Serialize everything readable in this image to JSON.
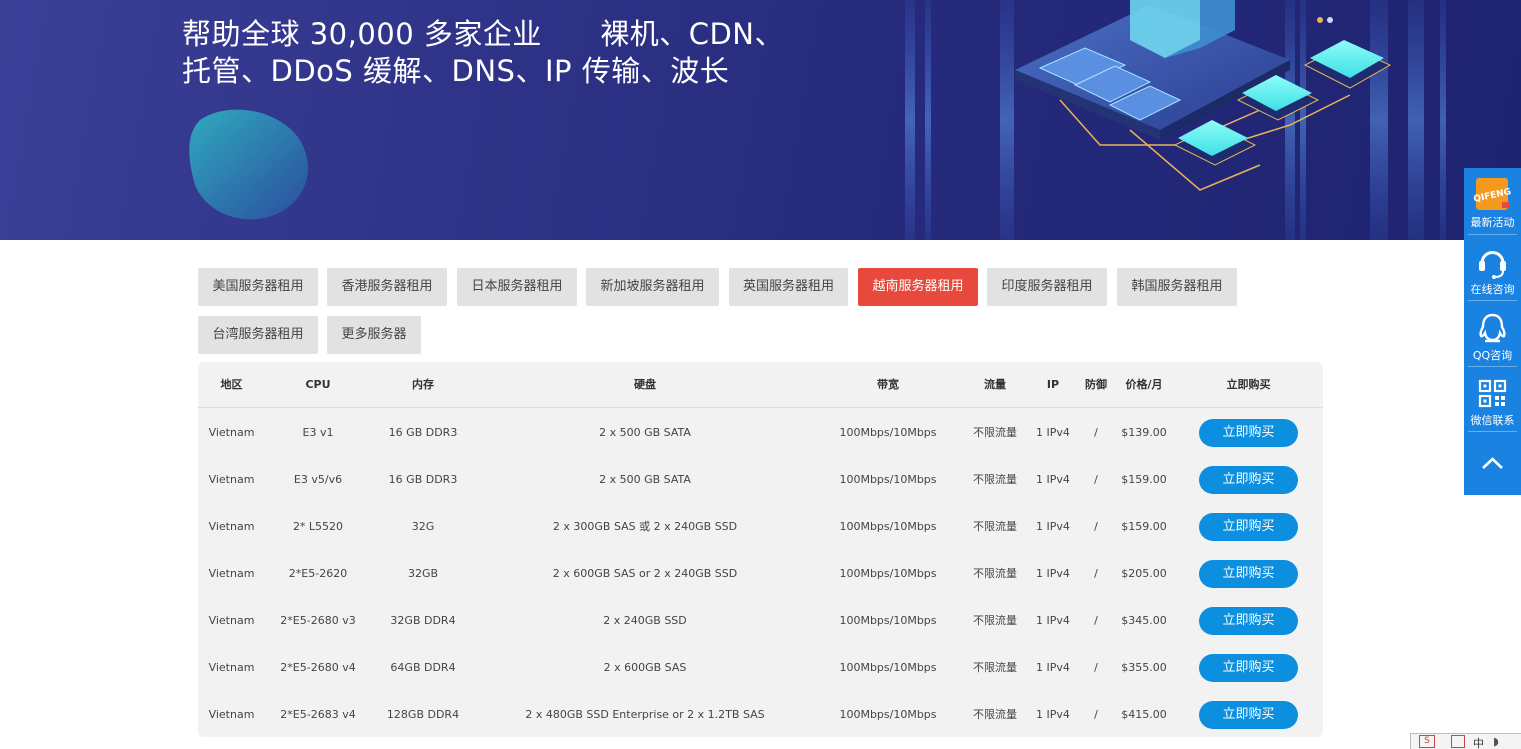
{
  "banner": {
    "line1": "帮助全球 30,000 多家企业      裸机、CDN、",
    "line2": "托管、DDoS 缓解、DNS、IP 传输、波长"
  },
  "tabs": [
    {
      "label": "美国服务器租用",
      "active": false
    },
    {
      "label": "香港服务器租用",
      "active": false
    },
    {
      "label": "日本服务器租用",
      "active": false
    },
    {
      "label": "新加坡服务器租用",
      "active": false
    },
    {
      "label": "英国服务器租用",
      "active": false
    },
    {
      "label": "越南服务器租用",
      "active": true
    },
    {
      "label": "印度服务器租用",
      "active": false
    },
    {
      "label": "韩国服务器租用",
      "active": false
    },
    {
      "label": "台湾服务器租用",
      "active": false
    },
    {
      "label": "更多服务器",
      "active": false
    }
  ],
  "table": {
    "headers": [
      "地区",
      "CPU",
      "内存",
      "硬盘",
      "带宽",
      "流量",
      "IP",
      "防御",
      "价格/月",
      "立即购买"
    ],
    "buy_label": "立即购买",
    "rows": [
      [
        "Vietnam",
        "E3 v1",
        "16 GB DDR3",
        "2 x 500 GB SATA",
        "100Mbps/10Mbps",
        "不限流量",
        "1 IPv4",
        "/",
        "$139.00"
      ],
      [
        "Vietnam",
        "E3 v5/v6",
        "16 GB DDR3",
        "2 x 500 GB SATA",
        "100Mbps/10Mbps",
        "不限流量",
        "1 IPv4",
        "/",
        "$159.00"
      ],
      [
        "Vietnam",
        "2* L5520",
        "32G",
        "2 x 300GB SAS 或 2 x 240GB SSD",
        "100Mbps/10Mbps",
        "不限流量",
        "1 IPv4",
        "/",
        "$159.00"
      ],
      [
        "Vietnam",
        "2*E5-2620",
        "32GB",
        "2 x 600GB SAS or 2 x 240GB SSD",
        "100Mbps/10Mbps",
        "不限流量",
        "1 IPv4",
        "/",
        "$205.00"
      ],
      [
        "Vietnam",
        "2*E5-2680 v3",
        "32GB DDR4",
        "2 x 240GB SSD",
        "100Mbps/10Mbps",
        "不限流量",
        "1 IPv4",
        "/",
        "$345.00"
      ],
      [
        "Vietnam",
        "2*E5-2680 v4",
        "64GB DDR4",
        "2 x 600GB SAS",
        "100Mbps/10Mbps",
        "不限流量",
        "1 IPv4",
        "/",
        "$355.00"
      ],
      [
        "Vietnam",
        "2*E5-2683 v4",
        "128GB DDR4",
        "2 x 480GB SSD Enterprise or 2 x 1.2TB SAS",
        "100Mbps/10Mbps",
        "不限流量",
        "1 IPv4",
        "/",
        "$415.00"
      ]
    ]
  },
  "float_bar": {
    "logo_text": "QIFENG",
    "items": [
      {
        "label": "最新活动",
        "icon": "logo-icon"
      },
      {
        "label": "在线咨询",
        "icon": "headset-icon"
      },
      {
        "label": "QQ咨询",
        "icon": "qq-icon"
      },
      {
        "label": "微信联系",
        "icon": "qr-code-icon"
      },
      {
        "label": "",
        "icon": "chevron-up-icon"
      }
    ]
  },
  "corner": {
    "char1": "中"
  },
  "colors": {
    "accent_red": "#e8493d",
    "button_blue": "#0d8fe0",
    "float_blue": "#1a83e2",
    "banner_dark": "#262a7c"
  }
}
